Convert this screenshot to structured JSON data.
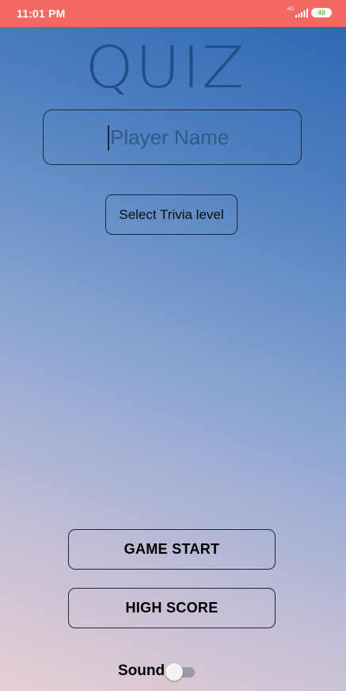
{
  "status_bar": {
    "time": "11:01 PM",
    "network": "4G",
    "battery": "48",
    "icons": [
      "signal-icon",
      "battery-icon"
    ]
  },
  "app": {
    "title": "QUIZ"
  },
  "player": {
    "placeholder": "Player Name",
    "value": ""
  },
  "trivia": {
    "level_label": "Select Trivia level"
  },
  "buttons": {
    "start_label": "GAME START",
    "high_score_label": "HIGH SCORE"
  },
  "sound": {
    "label": "Sound",
    "enabled": false
  },
  "colors": {
    "status_bar": "#f26a63",
    "gradient_top": "#2a64b3",
    "gradient_bottom": "#e7cfd3",
    "title": "#1f4f88"
  }
}
